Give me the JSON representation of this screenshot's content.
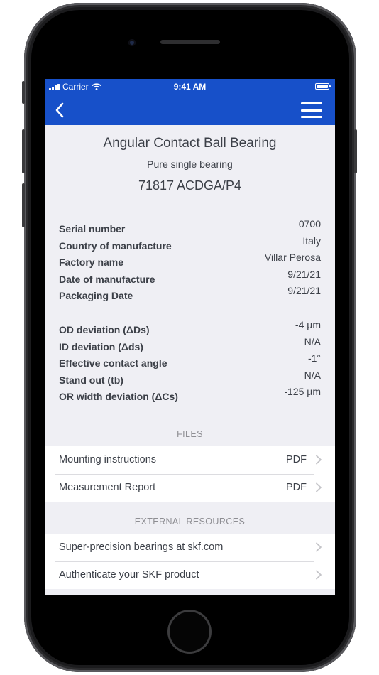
{
  "status_bar": {
    "carrier": "Carrier",
    "time": "9:41 AM"
  },
  "colors": {
    "brand_blue": "#1750c9",
    "background": "#efeff4",
    "text": "#3c4048",
    "section_header": "#8e8e93"
  },
  "product": {
    "title": "Angular Contact Ball Bearing",
    "subtitle": "Pure single bearing",
    "code": "71817 ACDGA/P4"
  },
  "details": [
    {
      "label": "Serial number",
      "value": "0700"
    },
    {
      "label": "Country of manufacture",
      "value": "Italy"
    },
    {
      "label": "Factory name",
      "value": "Villar Perosa"
    },
    {
      "label": "Date of manufacture",
      "value": "9/21/21"
    },
    {
      "label": "Packaging Date",
      "value": "9/21/21"
    }
  ],
  "measurements": [
    {
      "label": "OD deviation (ΔDs)",
      "value": "-4 µm"
    },
    {
      "label": "ID deviation (Δds)",
      "value": "N/A"
    },
    {
      "label": "Effective contact angle",
      "value": "-1°"
    },
    {
      "label": "Stand out (tb)",
      "value": "N/A"
    },
    {
      "label": "OR width deviation (ΔCs)",
      "value": "-125 µm"
    }
  ],
  "files": {
    "header": "FILES",
    "items": [
      {
        "label": "Mounting instructions",
        "badge": "PDF"
      },
      {
        "label": "Measurement Report",
        "badge": "PDF"
      }
    ]
  },
  "external": {
    "header": "EXTERNAL RESOURCES",
    "items": [
      {
        "label": "Super-precision bearings at skf.com"
      },
      {
        "label": "Authenticate your SKF product"
      }
    ]
  },
  "icons": {
    "back": "chevron-left-icon",
    "menu": "hamburger-menu-icon",
    "row": "chevron-right-icon"
  }
}
